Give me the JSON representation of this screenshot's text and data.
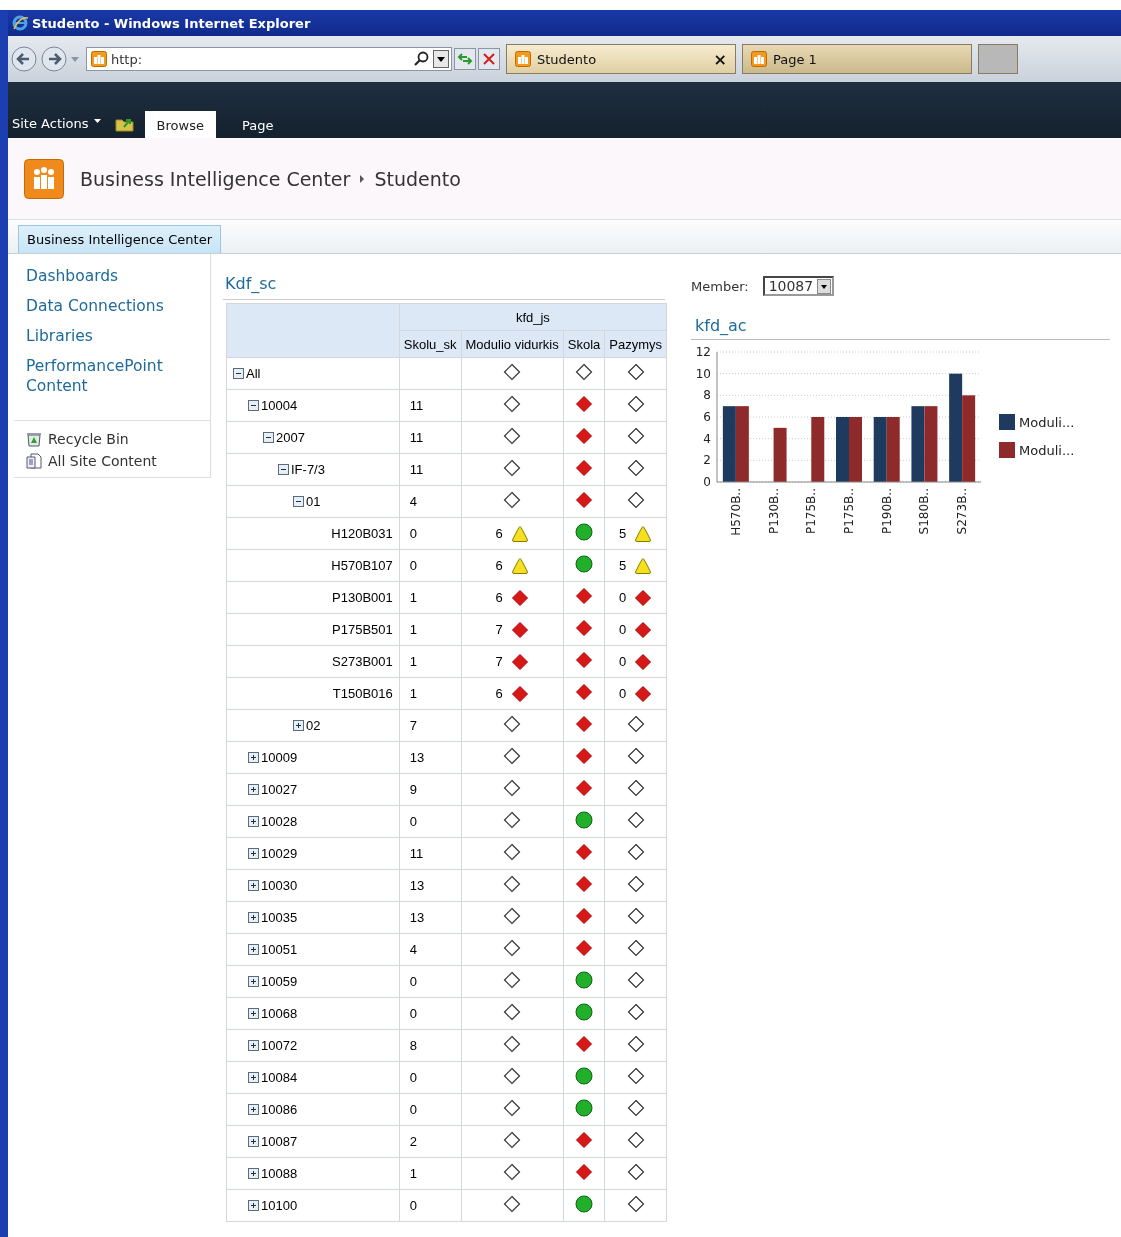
{
  "window": {
    "title": "Studento - Windows Internet Explorer"
  },
  "browser": {
    "address": "http:",
    "tabs": [
      {
        "label": "Studento",
        "selected": true,
        "close": "×"
      },
      {
        "label": "Page 1",
        "selected": false
      }
    ]
  },
  "ribbon": {
    "site_actions": "Site Actions",
    "tabs": [
      {
        "label": "Browse",
        "selected": true
      },
      {
        "label": "Page",
        "selected": false
      }
    ]
  },
  "header": {
    "breadcrumb": [
      "Business Intelligence Center",
      "Studento"
    ]
  },
  "top_nav": [
    {
      "label": "Business Intelligence Center",
      "selected": true
    }
  ],
  "sidebar": {
    "items": [
      "Dashboards",
      "Data Connections",
      "Libraries",
      "PerformancePoint Content"
    ],
    "tools": [
      {
        "label": "Recycle Bin",
        "kind": "recycle"
      },
      {
        "label": "All Site Content",
        "kind": "content"
      }
    ]
  },
  "scorecard": {
    "title": "Kdf_sc",
    "group_header": "kfd_js",
    "columns": [
      "Skolu_sk",
      "Modulio vidurkis",
      "Skola",
      "Pazymys"
    ],
    "rows": [
      {
        "label": "All",
        "expanded": true,
        "indicators": [
          {
            "kind": "none"
          },
          {
            "kind": "none"
          },
          {
            "kind": "none"
          }
        ],
        "children": [
          {
            "label": "10004",
            "expanded": true,
            "count": "11",
            "indicators": [
              {
                "kind": "none"
              },
              {
                "kind": "bad"
              },
              {
                "kind": "none"
              }
            ],
            "children": [
              {
                "label": "2007",
                "expanded": true,
                "count": "11",
                "indicators": [
                  {
                    "kind": "none"
                  },
                  {
                    "kind": "bad"
                  },
                  {
                    "kind": "none"
                  }
                ],
                "children": [
                  {
                    "label": "IF-7/3",
                    "expanded": true,
                    "count": "11",
                    "indicators": [
                      {
                        "kind": "none"
                      },
                      {
                        "kind": "bad"
                      },
                      {
                        "kind": "none"
                      }
                    ],
                    "children": [
                      {
                        "label": "01",
                        "expanded": true,
                        "count": "4",
                        "indicators": [
                          {
                            "kind": "none"
                          },
                          {
                            "kind": "bad"
                          },
                          {
                            "kind": "none"
                          }
                        ],
                        "children": [
                          {
                            "label": "H120B031",
                            "count": "0",
                            "indicators": [
                              {
                                "value": "6",
                                "kind": "warning"
                              },
                              {
                                "kind": "good"
                              },
                              {
                                "value": "5",
                                "kind": "warning"
                              }
                            ]
                          },
                          {
                            "label": "H570B107",
                            "count": "0",
                            "indicators": [
                              {
                                "value": "6",
                                "kind": "warning"
                              },
                              {
                                "kind": "good"
                              },
                              {
                                "value": "5",
                                "kind": "warning"
                              }
                            ]
                          },
                          {
                            "label": "P130B001",
                            "count": "1",
                            "indicators": [
                              {
                                "value": "6",
                                "kind": "bad"
                              },
                              {
                                "kind": "bad"
                              },
                              {
                                "value": "0",
                                "kind": "bad"
                              }
                            ]
                          },
                          {
                            "label": "P175B501",
                            "count": "1",
                            "indicators": [
                              {
                                "value": "7",
                                "kind": "bad"
                              },
                              {
                                "kind": "bad"
                              },
                              {
                                "value": "0",
                                "kind": "bad"
                              }
                            ]
                          },
                          {
                            "label": "S273B001",
                            "count": "1",
                            "indicators": [
                              {
                                "value": "7",
                                "kind": "bad"
                              },
                              {
                                "kind": "bad"
                              },
                              {
                                "value": "0",
                                "kind": "bad"
                              }
                            ]
                          },
                          {
                            "label": "T150B016",
                            "count": "1",
                            "indicators": [
                              {
                                "value": "6",
                                "kind": "bad"
                              },
                              {
                                "kind": "bad"
                              },
                              {
                                "value": "0",
                                "kind": "bad"
                              }
                            ]
                          }
                        ]
                      },
                      {
                        "label": "02",
                        "expanded": false,
                        "count": "7",
                        "indicators": [
                          {
                            "kind": "none"
                          },
                          {
                            "kind": "bad"
                          },
                          {
                            "kind": "none"
                          }
                        ]
                      }
                    ]
                  }
                ]
              }
            ]
          },
          {
            "label": "10009",
            "expanded": false,
            "count": "13",
            "indicators": [
              {
                "kind": "none"
              },
              {
                "kind": "bad"
              },
              {
                "kind": "none"
              }
            ]
          },
          {
            "label": "10027",
            "expanded": false,
            "count": "9",
            "indicators": [
              {
                "kind": "none"
              },
              {
                "kind": "bad"
              },
              {
                "kind": "none"
              }
            ]
          },
          {
            "label": "10028",
            "expanded": false,
            "count": "0",
            "indicators": [
              {
                "kind": "none"
              },
              {
                "kind": "good"
              },
              {
                "kind": "none"
              }
            ]
          },
          {
            "label": "10029",
            "expanded": false,
            "count": "11",
            "indicators": [
              {
                "kind": "none"
              },
              {
                "kind": "bad"
              },
              {
                "kind": "none"
              }
            ]
          },
          {
            "label": "10030",
            "expanded": false,
            "count": "13",
            "indicators": [
              {
                "kind": "none"
              },
              {
                "kind": "bad"
              },
              {
                "kind": "none"
              }
            ]
          },
          {
            "label": "10035",
            "expanded": false,
            "count": "13",
            "indicators": [
              {
                "kind": "none"
              },
              {
                "kind": "bad"
              },
              {
                "kind": "none"
              }
            ]
          },
          {
            "label": "10051",
            "expanded": false,
            "count": "4",
            "indicators": [
              {
                "kind": "none"
              },
              {
                "kind": "bad"
              },
              {
                "kind": "none"
              }
            ]
          },
          {
            "label": "10059",
            "expanded": false,
            "count": "0",
            "indicators": [
              {
                "kind": "none"
              },
              {
                "kind": "good"
              },
              {
                "kind": "none"
              }
            ]
          },
          {
            "label": "10068",
            "expanded": false,
            "count": "0",
            "indicators": [
              {
                "kind": "none"
              },
              {
                "kind": "good"
              },
              {
                "kind": "none"
              }
            ]
          },
          {
            "label": "10072",
            "expanded": false,
            "count": "8",
            "indicators": [
              {
                "kind": "none"
              },
              {
                "kind": "bad"
              },
              {
                "kind": "none"
              }
            ]
          },
          {
            "label": "10084",
            "expanded": false,
            "count": "0",
            "indicators": [
              {
                "kind": "none"
              },
              {
                "kind": "good"
              },
              {
                "kind": "none"
              }
            ]
          },
          {
            "label": "10086",
            "expanded": false,
            "count": "0",
            "indicators": [
              {
                "kind": "none"
              },
              {
                "kind": "good"
              },
              {
                "kind": "none"
              }
            ]
          },
          {
            "label": "10087",
            "expanded": false,
            "count": "2",
            "indicators": [
              {
                "kind": "none"
              },
              {
                "kind": "bad"
              },
              {
                "kind": "none"
              }
            ]
          },
          {
            "label": "10088",
            "expanded": false,
            "count": "1",
            "indicators": [
              {
                "kind": "none"
              },
              {
                "kind": "bad"
              },
              {
                "kind": "none"
              }
            ]
          },
          {
            "label": "10100",
            "expanded": false,
            "count": "0",
            "indicators": [
              {
                "kind": "none"
              },
              {
                "kind": "good"
              },
              {
                "kind": "none"
              }
            ]
          }
        ]
      }
    ]
  },
  "filter": {
    "label": "Member:",
    "value": "10087"
  },
  "chart_panel": {
    "title": "kfd_ac",
    "chart_data": {
      "type": "bar",
      "categories": [
        "H570B..",
        "P130B..",
        "P175B..",
        "P175B..",
        "P190B..",
        "S180B..",
        "S273B.."
      ],
      "series": [
        {
          "name": "Moduli...",
          "color": "#1f3a5f",
          "values": [
            7,
            null,
            null,
            6,
            6,
            7,
            10
          ]
        },
        {
          "name": "Moduli...",
          "color": "#8f2a2a",
          "values": [
            7,
            5,
            6,
            6,
            6,
            7,
            8
          ]
        }
      ],
      "ylim": [
        0,
        12
      ],
      "yticks": [
        0,
        2,
        4,
        6,
        8,
        10,
        12
      ],
      "grid": true
    }
  }
}
